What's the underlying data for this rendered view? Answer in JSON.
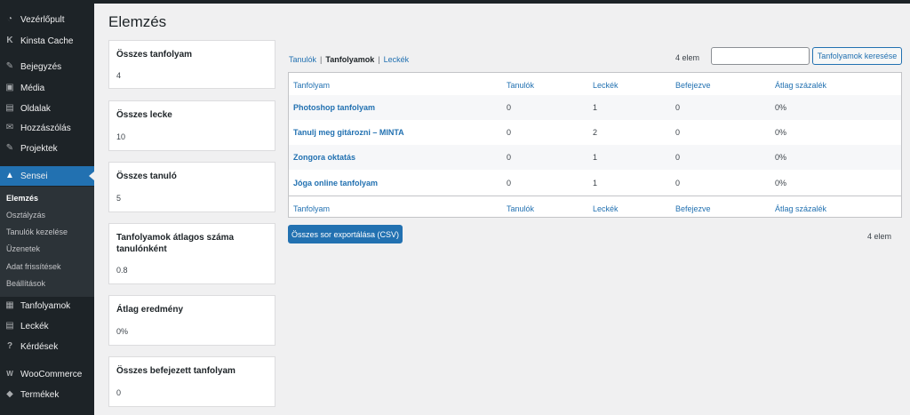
{
  "sidebar": {
    "items": [
      {
        "label": "Vezérlőpult",
        "icon": "dashboard-icon",
        "glyph": "◔"
      },
      {
        "label": "Kinsta Cache",
        "icon": "kinsta-icon",
        "glyph": "K"
      },
      {
        "label": "Bejegyzés",
        "icon": "pin-icon",
        "glyph": "✎"
      },
      {
        "label": "Média",
        "icon": "media-icon",
        "glyph": "▣"
      },
      {
        "label": "Oldalak",
        "icon": "pages-icon",
        "glyph": "▤"
      },
      {
        "label": "Hozzászólás",
        "icon": "comments-icon",
        "glyph": "✉"
      },
      {
        "label": "Projektek",
        "icon": "pin-icon",
        "glyph": "✎"
      },
      {
        "label": "Sensei",
        "icon": "graduation-cap-icon",
        "glyph": "▲"
      },
      {
        "label": "Tanfolyamok",
        "icon": "courses-icon",
        "glyph": "▦"
      },
      {
        "label": "Leckék",
        "icon": "lessons-icon",
        "glyph": "▤"
      },
      {
        "label": "Kérdések",
        "icon": "question-icon",
        "glyph": "?"
      },
      {
        "label": "WooCommerce",
        "icon": "woocommerce-icon",
        "glyph": "W"
      },
      {
        "label": "Termékek",
        "icon": "products-icon",
        "glyph": "◆"
      }
    ],
    "submenu": [
      "Elemzés",
      "Osztályzás",
      "Tanulók kezelése",
      "Üzenetek",
      "Adat frissítések",
      "Beállítások"
    ]
  },
  "page": {
    "title": "Elemzés"
  },
  "stats": [
    {
      "title": "Összes tanfolyam",
      "value": "4"
    },
    {
      "title": "Összes lecke",
      "value": "10"
    },
    {
      "title": "Összes tanuló",
      "value": "5"
    },
    {
      "title": "Tanfolyamok átlagos száma tanulónként",
      "value": "0.8"
    },
    {
      "title": "Átlag eredmény",
      "value": "0%"
    },
    {
      "title": "Összes befejezett tanfolyam",
      "value": "0"
    }
  ],
  "views": {
    "tanulok": "Tanulók",
    "tanfolyamok": "Tanfolyamok",
    "leckek": "Leckék",
    "separator": "|"
  },
  "count": "4 elem",
  "search": {
    "placeholder": "",
    "button": "Tanfolyamok keresése"
  },
  "table": {
    "columns": [
      "Tanfolyam",
      "Tanulók",
      "Leckék",
      "Befejezve",
      "Átlag százalék"
    ],
    "rows": [
      [
        "Photoshop tanfolyam",
        "0",
        "1",
        "0",
        "0%"
      ],
      [
        "Tanulj meg gitározni – MINTA",
        "0",
        "2",
        "0",
        "0%"
      ],
      [
        "Zongora oktatás",
        "0",
        "1",
        "0",
        "0%"
      ],
      [
        "Jóga online tanfolyam",
        "0",
        "1",
        "0",
        "0%"
      ]
    ]
  },
  "export_button": "Összes sor exportálása (CSV)",
  "colors": {
    "accent": "#2271b1",
    "sidebar": "#1d2327"
  }
}
